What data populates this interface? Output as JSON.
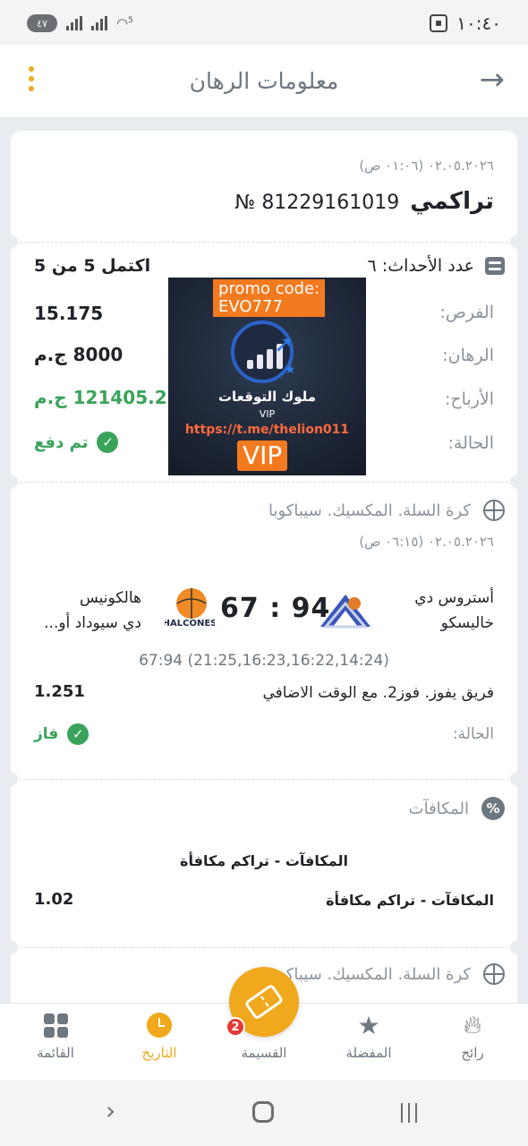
{
  "status_bar": {
    "time": "١٠:٤٠",
    "battery": "٤٧",
    "wifi_label": "5"
  },
  "header": {
    "title": "معلومات الرهان"
  },
  "bet": {
    "date": "٠٢.٠٥.٢٠٢٦ (٠١:٠٦ ص)",
    "type": "تراكمي",
    "number": "81229161019 №"
  },
  "summary": {
    "events_label": "عدد الأحداث: ٦",
    "completed": "اكتمل 5 من 5",
    "odds_label": "الفرص:",
    "odds_value": "15.175",
    "stake_label": "الرهان:",
    "stake_value": "8000 ج.م",
    "winnings_label": "الأرباح:",
    "winnings_value": "121405.21 ج.م",
    "status_label": "الحالة:",
    "status_value": "تم دفع"
  },
  "promo": {
    "code_line1": "promo code:",
    "code_line2": "EVO777",
    "brand": "ملوك التوقعات",
    "vip_small": "VIP",
    "link": "https://t.me/thelion011",
    "vip": "VIP"
  },
  "event": {
    "league": "كرة السلة. المكسيك. سيباكوبا",
    "date": "٠٢.٠٥.٢٠٢٦ (٠٦:١٥ ص)",
    "home_team_line1": "أستروس دي",
    "home_team_line2": "خاليسكو",
    "away_team_line1": "هالكونيس",
    "away_team_line2": "دي سيوداد أو...",
    "away_logo_text": "HALCONES",
    "score": "67 : 94",
    "periods": "67:94 (21:25,16:23,16:22,14:24)",
    "market": "فريق يفوز. فوز2. مع الوقت الاضافي",
    "market_odds": "1.251",
    "status_label": "الحالة:",
    "status_value": "فاز"
  },
  "bonus": {
    "title": "المكافآت",
    "subtitle": "المكافآت - تراكم مكافأة",
    "row_label": "المكافآت - تراكم مكافأة",
    "row_value": "1.02"
  },
  "next_event": {
    "league": "كرة السلة. المكسيك. سيباكوبا"
  },
  "bottom_nav": {
    "items": [
      {
        "label": "رائج",
        "icon": "flame-icon"
      },
      {
        "label": "المفضلة",
        "icon": "star-icon"
      },
      {
        "label": "القسيمة",
        "icon": "ticket-icon",
        "badge": "2"
      },
      {
        "label": "التاريخ",
        "icon": "clock-icon"
      },
      {
        "label": "القائمة",
        "icon": "grid-icon"
      }
    ]
  },
  "colors": {
    "accent": "#f0a81c",
    "success": "#3aa35a",
    "muted": "#8a949d",
    "badge": "#e53935"
  }
}
